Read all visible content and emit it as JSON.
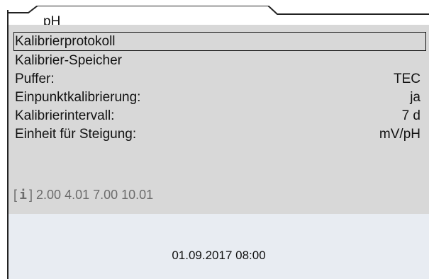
{
  "tab": {
    "label": "pH"
  },
  "menu": {
    "items": [
      {
        "label": "Kalibrierprotokoll",
        "value": ""
      },
      {
        "label": "Kalibrier-Speicher",
        "value": ""
      },
      {
        "label": "Puffer:",
        "value": "TEC"
      },
      {
        "label": "Einpunktkalibrierung:",
        "value": "ja"
      },
      {
        "label": "Kalibrierintervall:",
        "value": "7 d"
      },
      {
        "label": "Einheit für Steigung:",
        "value": "mV/pH"
      }
    ],
    "selected_label": "Kalibrierprotokoll"
  },
  "info": {
    "left_bracket": "[",
    "icon_glyph": "i",
    "icon_name": "info-icon",
    "right_bracket": "]",
    "text": " 2.00 4.01 7.00 10.01"
  },
  "status": {
    "datetime": "01.09.2017 08:00"
  }
}
